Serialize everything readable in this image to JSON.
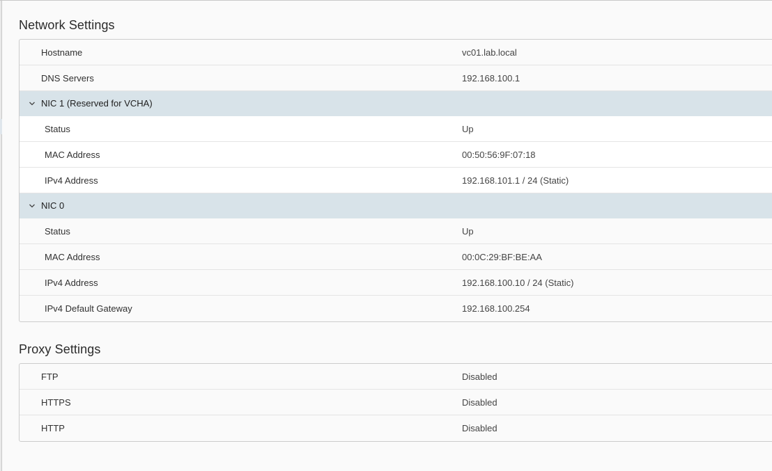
{
  "network": {
    "title": "Network Settings",
    "rows": [
      {
        "label": "Hostname",
        "value": "vc01.lab.local"
      },
      {
        "label": "DNS Servers",
        "value": "192.168.100.1"
      }
    ],
    "nic1": {
      "label": "NIC 1 (Reserved for VCHA)",
      "rows": [
        {
          "label": "Status",
          "value": "Up"
        },
        {
          "label": "MAC Address",
          "value": "00:50:56:9F:07:18"
        },
        {
          "label": "IPv4 Address",
          "value": "192.168.101.1 / 24 (Static)"
        }
      ]
    },
    "nic0": {
      "label": "NIC 0",
      "rows": [
        {
          "label": "Status",
          "value": "Up"
        },
        {
          "label": "MAC Address",
          "value": "00:0C:29:BF:BE:AA"
        },
        {
          "label": "IPv4 Address",
          "value": "192.168.100.10 / 24 (Static)"
        },
        {
          "label": "IPv4 Default Gateway",
          "value": "192.168.100.254"
        }
      ]
    }
  },
  "proxy": {
    "title": "Proxy Settings",
    "rows": [
      {
        "label": "FTP",
        "value": "Disabled"
      },
      {
        "label": "HTTPS",
        "value": "Disabled"
      },
      {
        "label": "HTTP",
        "value": "Disabled"
      }
    ]
  },
  "icons": {
    "group_toggle": "chevron-down-icon"
  },
  "colors": {
    "group_row_bg": "#d8e3e9",
    "page_bg": "#fafafa",
    "border": "#cccccc"
  }
}
